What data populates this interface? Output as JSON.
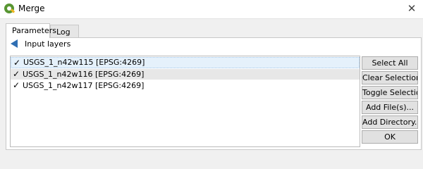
{
  "window": {
    "title": "Merge",
    "close_glyph": "✕"
  },
  "tabs": [
    {
      "label": "Parameters",
      "active": true
    },
    {
      "label": "Log",
      "active": false
    }
  ],
  "header": {
    "back_icon": "left-arrow-icon",
    "label": "Input layers"
  },
  "layers": [
    {
      "label": "USGS_1_n42w115 [EPSG:4269]",
      "checked": true
    },
    {
      "label": "USGS_1_n42w116 [EPSG:4269]",
      "checked": true
    },
    {
      "label": "USGS_1_n42w117 [EPSG:4269]",
      "checked": true
    }
  ],
  "check_glyph": "✓",
  "buttons": {
    "select_all": "Select All",
    "clear_selection": "Clear Selection",
    "toggle_selection": "Toggle Selection",
    "add_files": "Add File(s)...",
    "add_directory": "Add Directory...",
    "ok": "OK"
  },
  "colors": {
    "accent": "#2f6fb3",
    "qgis_green": "#589632",
    "qgis_yellow": "#f0b61f"
  }
}
